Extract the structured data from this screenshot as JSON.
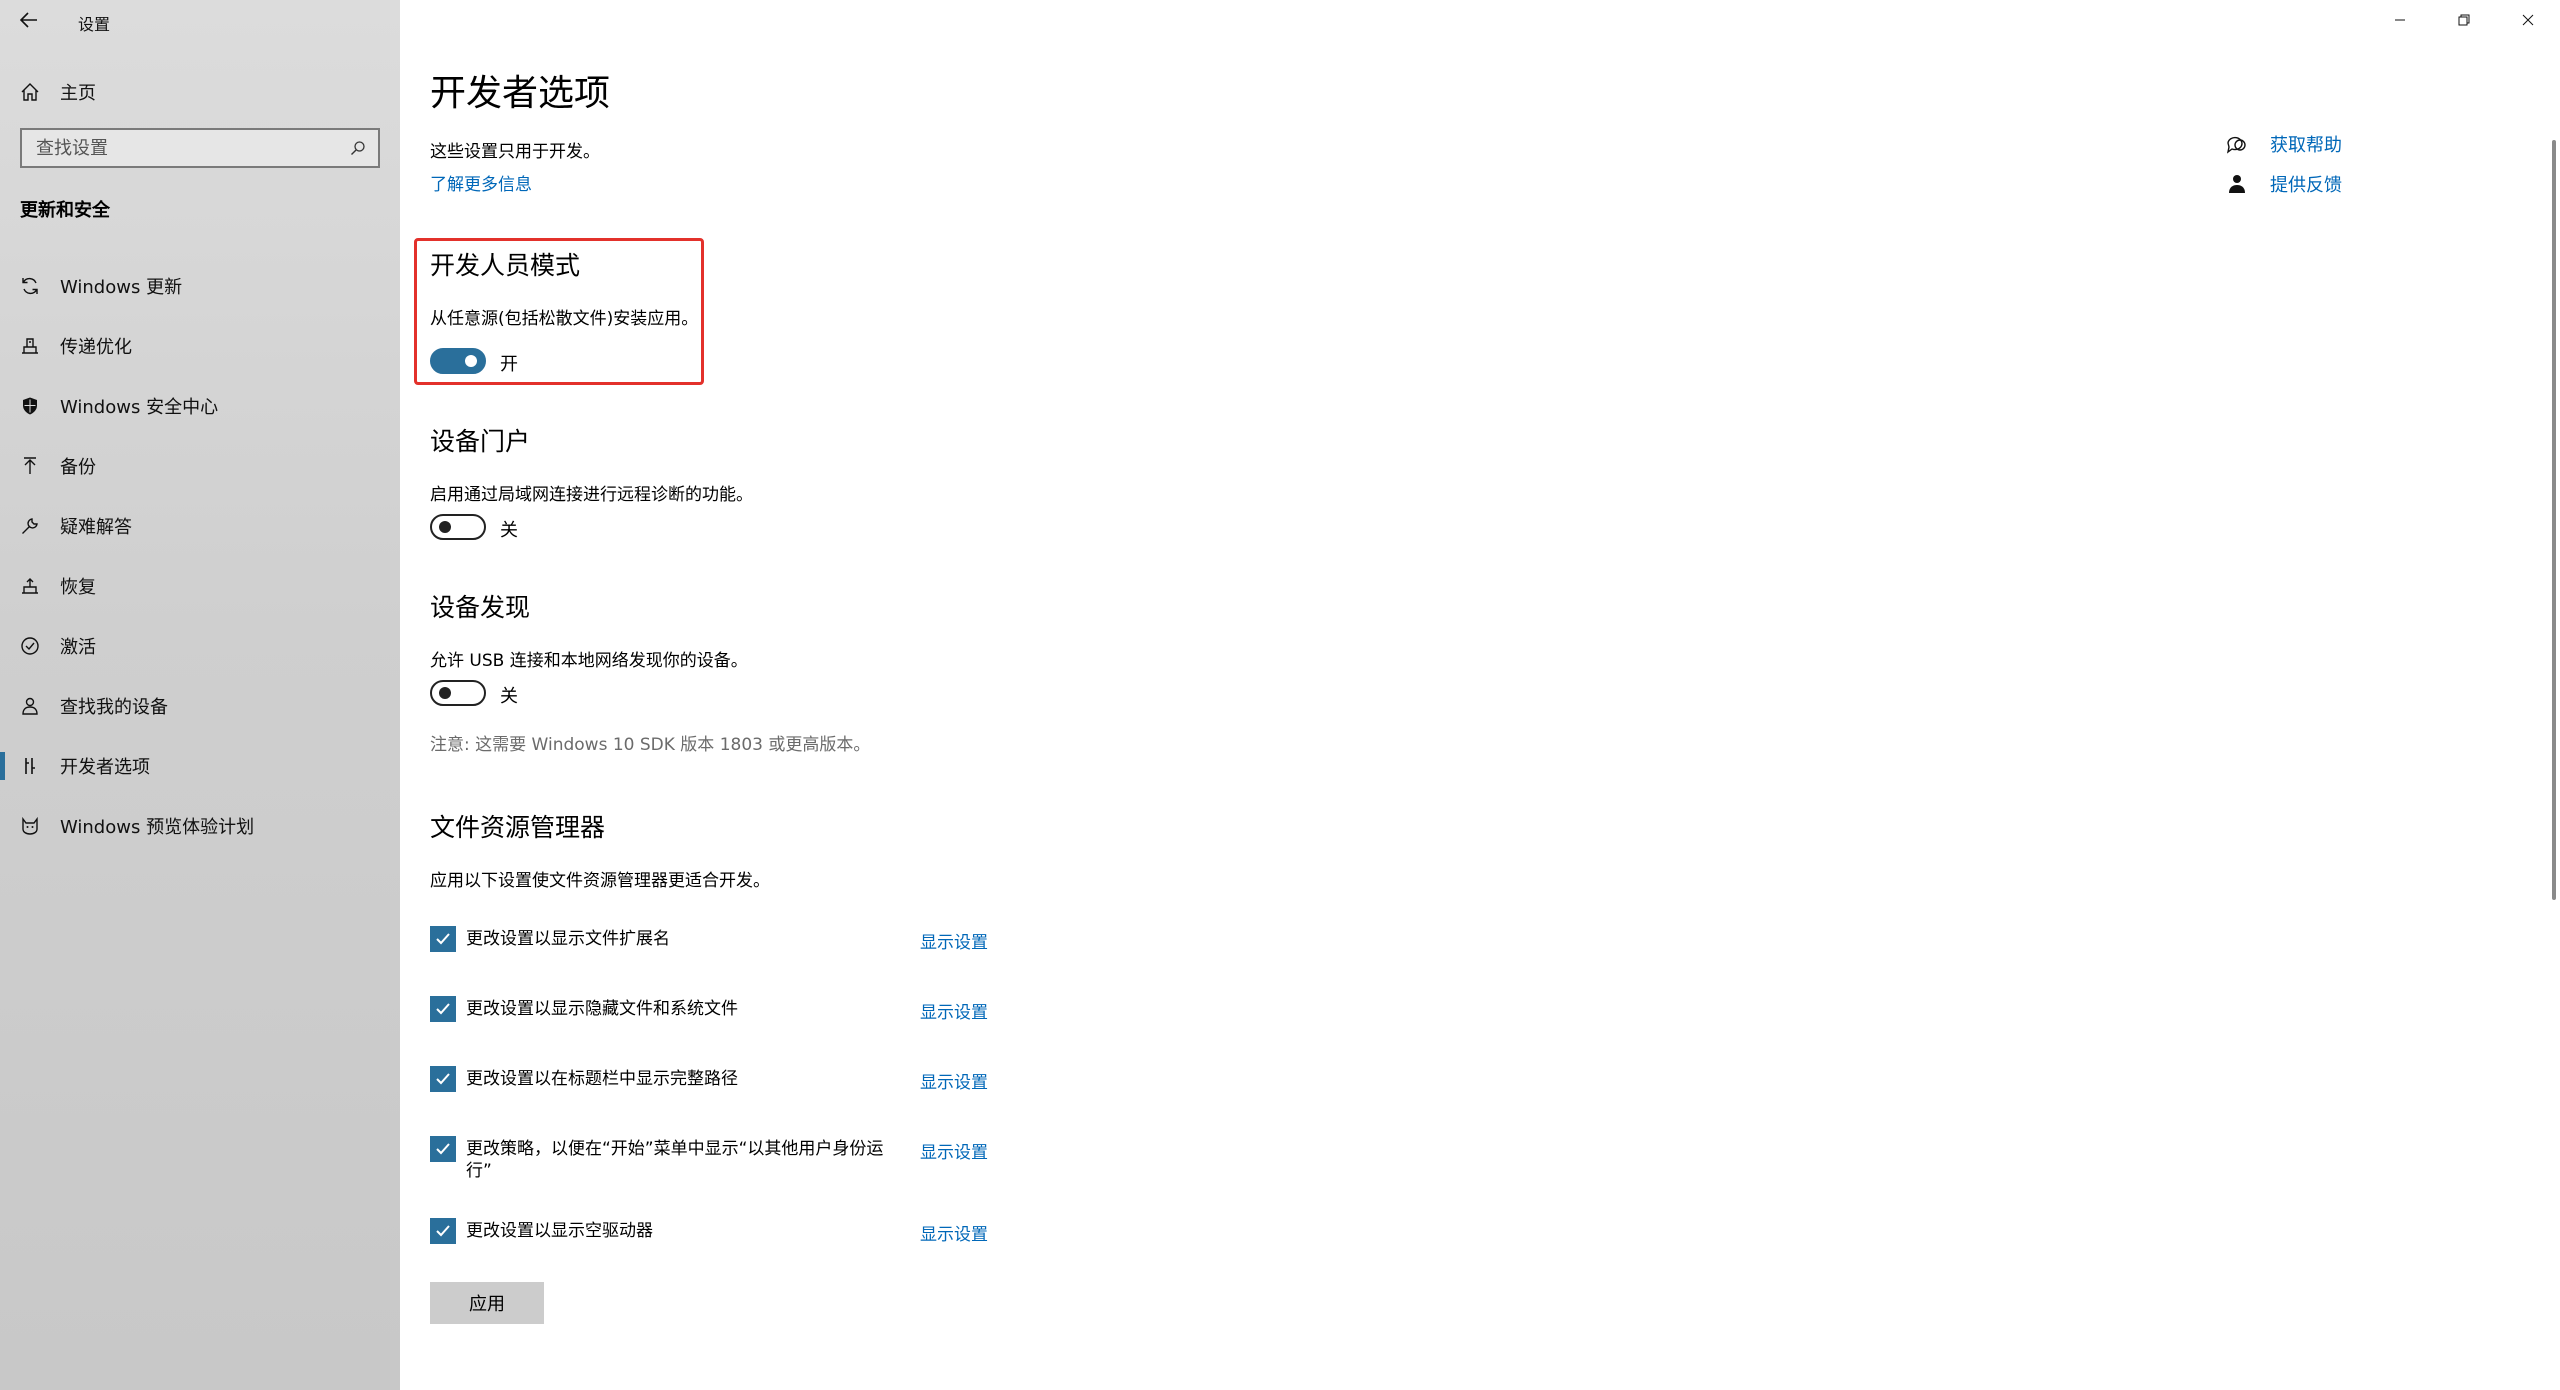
{
  "app": {
    "title": "设置"
  },
  "sidebar": {
    "home_label": "主页",
    "search_placeholder": "查找设置",
    "section_title": "更新和安全",
    "items": [
      {
        "label": "Windows 更新",
        "icon": "sync-icon"
      },
      {
        "label": "传递优化",
        "icon": "delivery-optimization-icon"
      },
      {
        "label": "Windows 安全中心",
        "icon": "shield-icon"
      },
      {
        "label": "备份",
        "icon": "backup-arrow-icon"
      },
      {
        "label": "疑难解答",
        "icon": "wrench-icon"
      },
      {
        "label": "恢复",
        "icon": "recovery-icon"
      },
      {
        "label": "激活",
        "icon": "check-circle-icon"
      },
      {
        "label": "查找我的设备",
        "icon": "find-device-icon"
      },
      {
        "label": "开发者选项",
        "icon": "developer-tools-icon",
        "selected": true
      },
      {
        "label": "Windows 预览体验计划",
        "icon": "insider-cat-icon"
      }
    ]
  },
  "main": {
    "title": "开发者选项",
    "subtitle": "这些设置只用于开发。",
    "learn_more": "了解更多信息",
    "developer_mode": {
      "heading": "开发人员模式",
      "description": "从任意源(包括松散文件)安装应用。",
      "state": "开",
      "on": true
    },
    "device_portal": {
      "heading": "设备门户",
      "description": "启用通过局域网连接进行远程诊断的功能。",
      "state": "关",
      "on": false
    },
    "device_discovery": {
      "heading": "设备发现",
      "description": "允许 USB 连接和本地网络发现你的设备。",
      "state": "关",
      "on": false,
      "note": "注意: 这需要 Windows 10 SDK 版本 1803 或更高版本。"
    },
    "file_explorer": {
      "heading": "文件资源管理器",
      "description": "应用以下设置使文件资源管理器更适合开发。",
      "options": [
        {
          "label": "更改设置以显示文件扩展名",
          "link": "显示设置",
          "checked": true
        },
        {
          "label": "更改设置以显示隐藏文件和系统文件",
          "link": "显示设置",
          "checked": true
        },
        {
          "label": "更改设置以在标题栏中显示完整路径",
          "link": "显示设置",
          "checked": true
        },
        {
          "label": "更改策略，以便在“开始”菜单中显示“以其他用户身份运行”",
          "link": "显示设置",
          "checked": true
        },
        {
          "label": "更改设置以显示空驱动器",
          "link": "显示设置",
          "checked": true
        }
      ],
      "apply_label": "应用"
    },
    "help": {
      "get_help": "获取帮助",
      "feedback": "提供反馈"
    }
  },
  "colors": {
    "accent": "#2a6f9b",
    "link": "#0067b8",
    "highlight": "#e3312b"
  }
}
